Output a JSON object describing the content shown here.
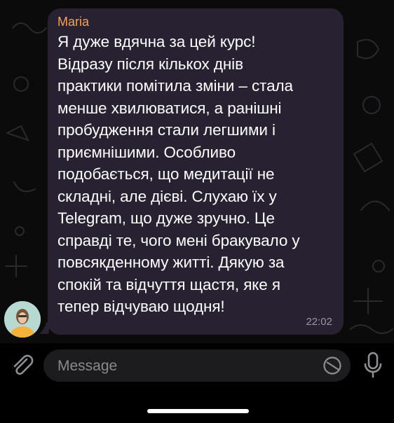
{
  "message": {
    "sender": "Maria",
    "text": "Я дуже вдячна за цей курс!\nВідразу після кількох днів\nпрактики помітила зміни – стала\nменше хвилюватися, а ранішні\nпробудження стали легшими і\nприємнішими. Особливо\nподобається, що медитації не\nскладні, але дієві. Слухаю їх у\nTelegram, що дуже зручно. Це\nсправді те, чого мені бракувало у\nповсякденному житті. Дякую за\nспокій та відчуття щастя, яке я\nтепер відчуваю щодня!",
    "time": "22:02"
  },
  "composer": {
    "placeholder": "Message",
    "value": ""
  },
  "icons": {
    "attach": "paperclip-icon",
    "sticker": "sticker-icon",
    "mic": "microphone-icon"
  },
  "colors": {
    "bubble": "#272131",
    "sender": "#f5a25d",
    "background": "#0b0b0c"
  }
}
